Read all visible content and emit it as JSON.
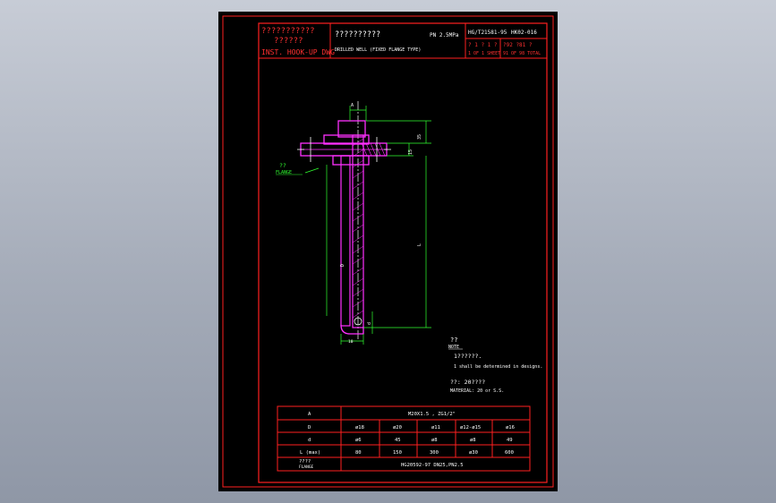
{
  "title_block": {
    "name_cn_line1": "???????????",
    "name_cn_line2": "??????",
    "name_en": "INST. HOOK-UP DWG",
    "desc_cn": "??????????",
    "pressure": "PN 2.5MPa",
    "desc_en": "DRILLED WELL (FIXED FLANGE TYPE)",
    "standard": "HG/T21581-95",
    "drawing_no": "HK02-016",
    "sheet_cn": "? 1  ? 1  ?",
    "sheet_en": "1 OF 1  SHEET",
    "page_cn": "?92  ?81 ?",
    "page_en": "91 OF 98 TOTAL"
  },
  "drawing": {
    "label_dim_top": "A",
    "label_dim_right_top": "35",
    "label_dim_right_small": "15",
    "label_length": "L",
    "label_dia": "D",
    "label_tip": "d",
    "label_bottom": "10",
    "flange_label_cn": "??",
    "flange_label_en": "FLANGE"
  },
  "notes": {
    "note_cn": "??",
    "note_en": "NOTE",
    "line1_cn": "1??????.",
    "line1_en": "1 shall be determined in designs.",
    "material_cn": "??: 20????",
    "material_en": "MATERIAL: 20 or S.S."
  },
  "spec_table": {
    "row_a": {
      "label": "A",
      "value": "M20X1.5  ,  ZG1/2\""
    },
    "row_d": {
      "label": "D",
      "cells": [
        "ø18",
        "ø20",
        "ø11",
        "ø12-ø15",
        "ø16"
      ]
    },
    "row_dd": {
      "label": "d",
      "cells": [
        "ø6",
        "45",
        "ø8",
        "ø8",
        "49"
      ]
    },
    "row_l": {
      "label": "L (max)",
      "cells": [
        "80",
        "150",
        "300",
        "ø30",
        "600"
      ]
    },
    "row_flange": {
      "label_cn": "????",
      "label_en": "FLANGE",
      "value": "HG20592-97    DN25,PN2.5"
    }
  }
}
